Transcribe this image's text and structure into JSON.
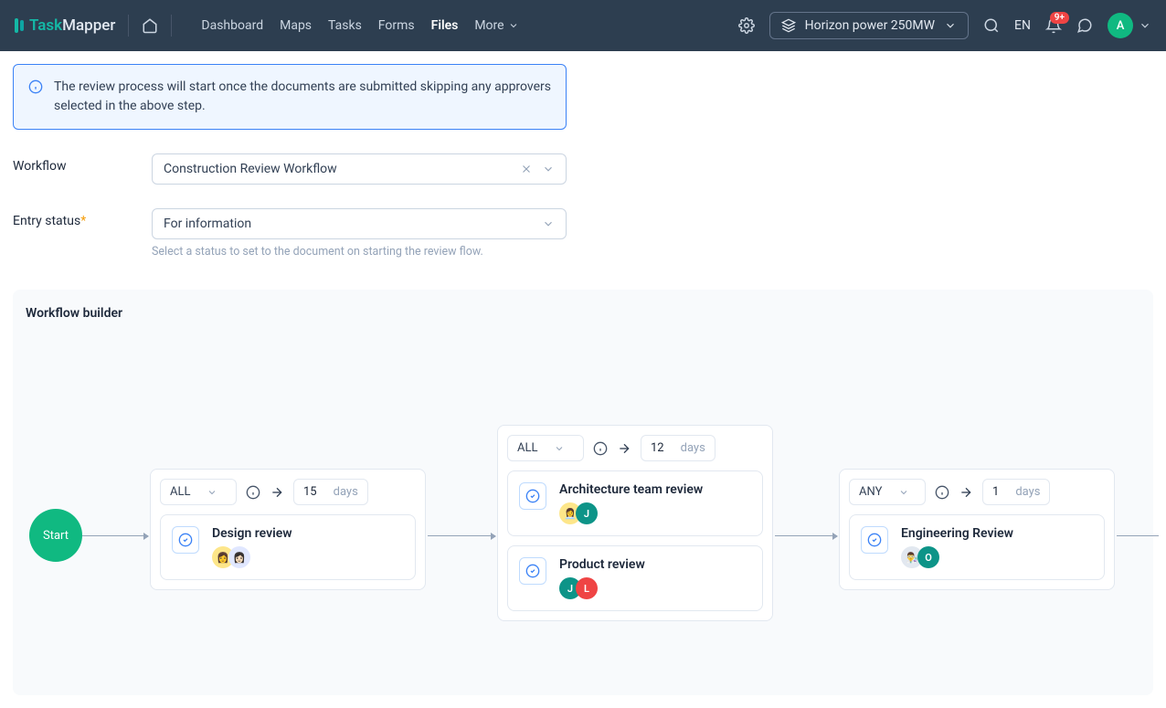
{
  "header": {
    "brand_task": "Task",
    "brand_mapper": "Mapper",
    "nav": {
      "dashboard": "Dashboard",
      "maps": "Maps",
      "tasks": "Tasks",
      "forms": "Forms",
      "files": "Files",
      "more": "More"
    },
    "project": "Horizon power 250MW",
    "lang": "EN",
    "badge": "9+",
    "avatar": "A"
  },
  "info": "The review process will start once the documents are submitted skipping any approvers selected in the above step.",
  "form": {
    "workflow_label": "Workflow",
    "workflow_value": "Construction Review Workflow",
    "entry_label": "Entry status",
    "entry_value": "For information",
    "entry_helper": "Select a status to set to the document on starting the review flow."
  },
  "builder": {
    "title": "Workflow builder",
    "start": "Start",
    "days_label": "days",
    "stages": [
      {
        "rule": "ALL",
        "days": "15",
        "reviews": [
          {
            "title": "Design review",
            "avatars": [
              {
                "cls": "emoji",
                "txt": "👩"
              },
              {
                "cls": "blue",
                "txt": "👩🏻"
              }
            ]
          }
        ]
      },
      {
        "rule": "ALL",
        "days": "12",
        "reviews": [
          {
            "title": "Architecture team review",
            "avatars": [
              {
                "cls": "emoji",
                "txt": "👩‍💼"
              },
              {
                "cls": "teal",
                "txt": "J"
              }
            ]
          },
          {
            "title": "Product review",
            "avatars": [
              {
                "cls": "teal",
                "txt": "J"
              },
              {
                "cls": "red",
                "txt": "L"
              }
            ]
          }
        ]
      },
      {
        "rule": "ANY",
        "days": "1",
        "reviews": [
          {
            "title": "Engineering Review",
            "avatars": [
              {
                "cls": "grey",
                "txt": "👨‍🔬"
              },
              {
                "cls": "teal",
                "txt": "O"
              }
            ]
          }
        ]
      }
    ]
  }
}
